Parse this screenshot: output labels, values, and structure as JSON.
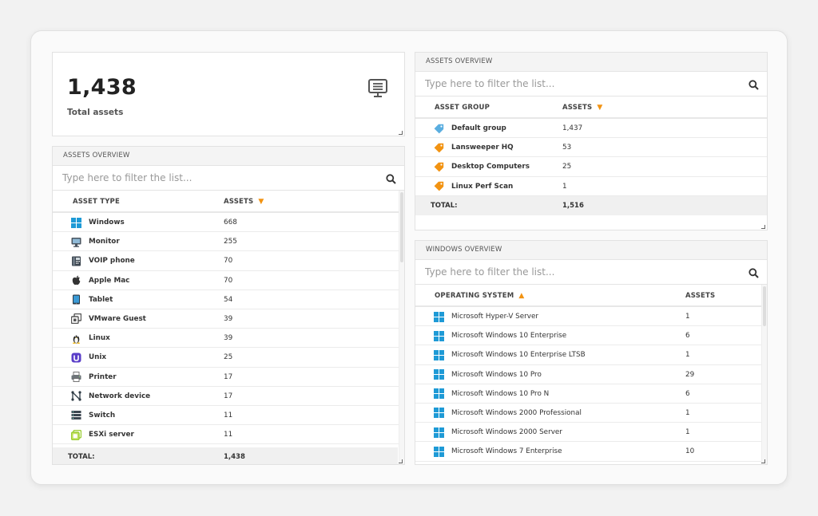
{
  "kpi": {
    "value": "1,438",
    "label": "Total assets",
    "icon": "monitor-list-icon"
  },
  "asset_types": {
    "title": "ASSETS OVERVIEW",
    "filter_placeholder": "Type here to filter the list...",
    "col_type": "ASSET TYPE",
    "col_assets": "ASSETS",
    "sort": "desc",
    "rows": [
      {
        "name": "Windows",
        "count": "668",
        "icon": "windows-icon"
      },
      {
        "name": "Monitor",
        "count": "255",
        "icon": "monitor-icon"
      },
      {
        "name": "VOIP phone",
        "count": "70",
        "icon": "voip-phone-icon"
      },
      {
        "name": "Apple Mac",
        "count": "70",
        "icon": "apple-icon"
      },
      {
        "name": "Tablet",
        "count": "54",
        "icon": "tablet-icon"
      },
      {
        "name": "VMware Guest",
        "count": "39",
        "icon": "vmware-icon"
      },
      {
        "name": "Linux",
        "count": "39",
        "icon": "linux-icon"
      },
      {
        "name": "Unix",
        "count": "25",
        "icon": "unix-icon"
      },
      {
        "name": "Printer",
        "count": "17",
        "icon": "printer-icon"
      },
      {
        "name": "Network device",
        "count": "17",
        "icon": "network-device-icon"
      },
      {
        "name": "Switch",
        "count": "11",
        "icon": "switch-icon"
      },
      {
        "name": "ESXi server",
        "count": "11",
        "icon": "esxi-icon"
      }
    ],
    "total_label": "TOTAL:",
    "total_value": "1,438"
  },
  "asset_groups": {
    "title": "ASSETS OVERVIEW",
    "filter_placeholder": "Type here to filter the list...",
    "col_group": "ASSET GROUP",
    "col_assets": "ASSETS",
    "sort": "desc",
    "rows": [
      {
        "name": "Default group",
        "count": "1,437",
        "color": "#5aaee0"
      },
      {
        "name": "Lansweeper HQ",
        "count": "53",
        "color": "#f29312"
      },
      {
        "name": "Desktop Computers",
        "count": "25",
        "color": "#f29312"
      },
      {
        "name": "Linux Perf Scan",
        "count": "1",
        "color": "#f29312"
      }
    ],
    "total_label": "TOTAL:",
    "total_value": "1,516"
  },
  "windows": {
    "title": "WINDOWS OVERVIEW",
    "filter_placeholder": "Type here to filter the list...",
    "col_os": "OPERATING SYSTEM",
    "col_assets": "ASSETS",
    "sort": "asc",
    "rows": [
      {
        "name": "Microsoft Hyper-V Server",
        "count": "1"
      },
      {
        "name": "Microsoft Windows 10 Enterprise",
        "count": "6"
      },
      {
        "name": "Microsoft Windows 10 Enterprise LTSB",
        "count": "1"
      },
      {
        "name": "Microsoft Windows 10 Pro",
        "count": "29"
      },
      {
        "name": "Microsoft Windows 10 Pro N",
        "count": "6"
      },
      {
        "name": "Microsoft Windows 2000 Professional",
        "count": "1"
      },
      {
        "name": "Microsoft Windows 2000 Server",
        "count": "1"
      },
      {
        "name": "Microsoft Windows 7 Enterprise",
        "count": "10"
      }
    ]
  },
  "colors": {
    "accent": "#f29312",
    "windows_blue": "#1e9ad6",
    "tag_blue": "#5aaee0"
  }
}
